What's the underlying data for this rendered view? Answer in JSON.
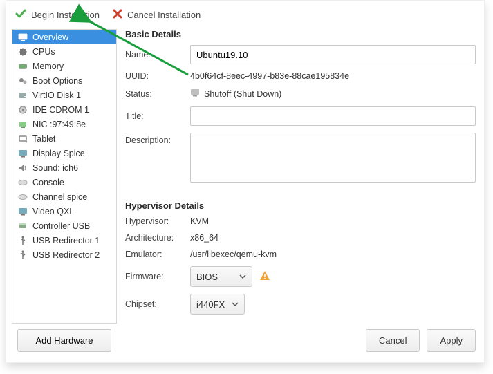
{
  "toolbar": {
    "begin_label": "Begin Installation",
    "cancel_label": "Cancel Installation"
  },
  "sidebar": {
    "items": [
      {
        "label": "Overview"
      },
      {
        "label": "CPUs"
      },
      {
        "label": "Memory"
      },
      {
        "label": "Boot Options"
      },
      {
        "label": "VirtIO Disk 1"
      },
      {
        "label": "IDE CDROM 1"
      },
      {
        "label": "NIC :97:49:8e"
      },
      {
        "label": "Tablet"
      },
      {
        "label": "Display Spice"
      },
      {
        "label": "Sound: ich6"
      },
      {
        "label": "Console"
      },
      {
        "label": "Channel spice"
      },
      {
        "label": "Video QXL"
      },
      {
        "label": "Controller USB"
      },
      {
        "label": "USB Redirector 1"
      },
      {
        "label": "USB Redirector 2"
      }
    ],
    "add_hardware_label": "Add Hardware"
  },
  "basic": {
    "section_title": "Basic Details",
    "name_label": "Name:",
    "name_value": "Ubuntu19.10",
    "uuid_label": "UUID:",
    "uuid_value": "4b0f64cf-8eec-4997-b83e-88cae195834e",
    "status_label": "Status:",
    "status_value": "Shutoff (Shut Down)",
    "title_label": "Title:",
    "title_value": "",
    "desc_label": "Description:",
    "desc_value": ""
  },
  "hv": {
    "section_title": "Hypervisor Details",
    "hypervisor_label": "Hypervisor:",
    "hypervisor_value": "KVM",
    "arch_label": "Architecture:",
    "arch_value": "x86_64",
    "emulator_label": "Emulator:",
    "emulator_value": "/usr/libexec/qemu-kvm",
    "firmware_label": "Firmware:",
    "firmware_value": "BIOS",
    "chipset_label": "Chipset:",
    "chipset_value": "i440FX"
  },
  "footer": {
    "cancel_label": "Cancel",
    "apply_label": "Apply"
  }
}
